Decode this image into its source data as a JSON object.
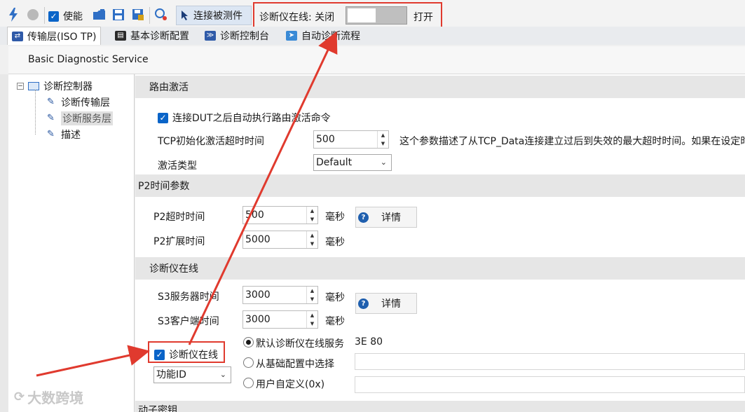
{
  "toolbar": {
    "enable_label": "使能",
    "connect_label": "连接被测件",
    "online_status_label": "诊断仪在线: 关闭",
    "open_label": "打开"
  },
  "tabs": [
    {
      "label": "传输层(ISO TP)",
      "icon": "transport-icon"
    },
    {
      "label": "基本诊断配置",
      "icon": "config-icon"
    },
    {
      "label": "诊断控制台",
      "icon": "console-icon"
    },
    {
      "label": "自动诊断流程",
      "icon": "send-icon"
    }
  ],
  "service_title": "Basic Diagnostic Service",
  "tree": {
    "root": "诊断控制器",
    "children": [
      "诊断传输层",
      "诊断服务层",
      "描述"
    ]
  },
  "routing": {
    "header": "路由激活",
    "auto_route_label": "连接DUT之后自动执行路由激活命令",
    "tcp_timeout_label": "TCP初始化激活超时时间",
    "tcp_timeout_value": "500",
    "tcp_desc": "这个参数描述了从TCP_Data连接建立过后到失效的最大超时时间。如果在设定时",
    "activation_type_label": "激活类型",
    "activation_type_value": "Default"
  },
  "p2": {
    "header": "P2时间参数",
    "timeout_label": "P2超时时间",
    "timeout_value": "500",
    "extend_label": "P2扩展时间",
    "extend_value": "5000",
    "unit": "毫秒",
    "detail_label": "详情"
  },
  "tester_present": {
    "header": "诊断仪在线",
    "s3_server_label": "S3服务器时间",
    "s3_server_value": "3000",
    "s3_client_label": "S3客户端时间",
    "s3_client_value": "3000",
    "unit": "毫秒",
    "detail_label": "详情",
    "online_checkbox_label": "诊断仪在线",
    "function_id_value": "功能ID",
    "radio_default_label": "默认诊断仪在线服务",
    "radio_default_value": "3E 80",
    "radio_base_label": "从基础配置中选择",
    "radio_custom_label": "用户自定义(0x)"
  },
  "next_section_partial": "动子密钥",
  "watermark": "大数跨境",
  "colors": {
    "highlight_red": "#e03a2e",
    "accent_blue": "#0a64c8"
  }
}
